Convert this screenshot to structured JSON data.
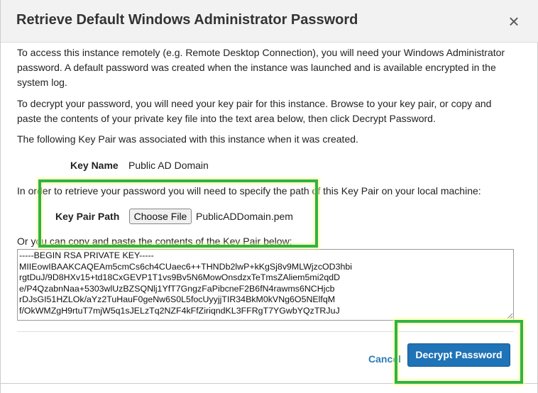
{
  "dialog": {
    "title": "Retrieve Default Windows Administrator Password",
    "close_label": "×"
  },
  "body": {
    "para1": "To access this instance remotely (e.g. Remote Desktop Connection), you will need your Windows Administrator password. A default password was created when the instance was launched and is available encrypted in the system log.",
    "para2": "To decrypt your password, you will need your key pair for this instance. Browse to your key pair, or copy and paste the contents of your private key file into the text area below, then click Decrypt Password.",
    "para3": "The following Key Pair was associated with this instance when it was created.",
    "key_name_label": "Key Name",
    "key_name_value": "Public AD Domain",
    "retrieve_text": "In order to retrieve your password you will need to specify the path of this Key Pair on your local machine:",
    "key_pair_path_label": "Key Pair Path",
    "choose_file_label": "Choose File",
    "selected_file": "PublicADDomain.pem",
    "copy_paste_text": "Or you can copy and paste the contents of the Key Pair below:",
    "private_key_text": "-----BEGIN RSA PRIVATE KEY-----\nMIIEowIBAAKCAQEAm5cmCs6ch4CUaec6++THNDb2lwP+kKgSj8v9MLWjzcOD3hbi\nrgtDuJ/9D8HXv15+td18CxGEVP1T1vs9Bv5N6MowOnsdzxTeTmsZAliem5mi2qdD\ne/P4QzabnNaa+5303wlUzBZSQNlj1YfT7GngzFaPibcneF2B6fN4rawms6NCHjcb\nrDJsGI51HZLOk/aYz2TuHauF0geNw6S0L5focUyyjjTIR34BkM0kVNg6O5NElfqM\nf/OkWMZgH9rtuT7mjW5q1sJELzTq2NZF4kFfZiriqndKL3FFRgT7YGwbYQzTRJuJ"
  },
  "footer": {
    "cancel_label": "Cancel",
    "decrypt_label": "Decrypt Password"
  },
  "colors": {
    "primary_button": "#1f73b7",
    "link": "#2b7bb9",
    "highlight_border": "#2fb24a"
  }
}
